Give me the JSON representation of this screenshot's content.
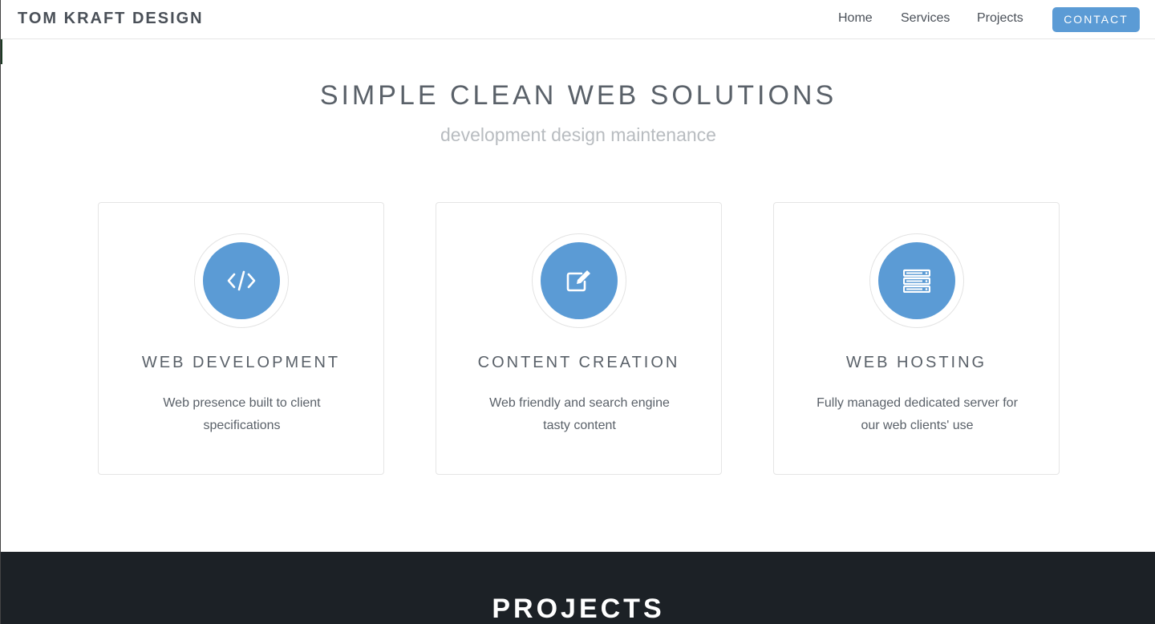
{
  "navbar": {
    "brand": "TOM KRAFT DESIGN",
    "links": [
      "Home",
      "Services",
      "Projects"
    ],
    "contact_label": "CONTACT"
  },
  "hero": {
    "title": "SIMPLE CLEAN WEB SOLUTIONS",
    "subtitle": "development design maintenance"
  },
  "services": [
    {
      "icon": "code-icon",
      "title": "WEB DEVELOPMENT",
      "description": "Web presence built to client specifications"
    },
    {
      "icon": "edit-icon",
      "title": "CONTENT CREATION",
      "description": "Web friendly and search engine tasty content"
    },
    {
      "icon": "server-icon",
      "title": "WEB HOSTING",
      "description": "Fully managed dedicated server for our web clients' use"
    }
  ],
  "projects": {
    "title": "PROJECTS"
  },
  "colors": {
    "accent": "#5b9bd5",
    "dark_section": "#1c2126",
    "text": "#5a6169",
    "muted": "#b8bcc0"
  }
}
